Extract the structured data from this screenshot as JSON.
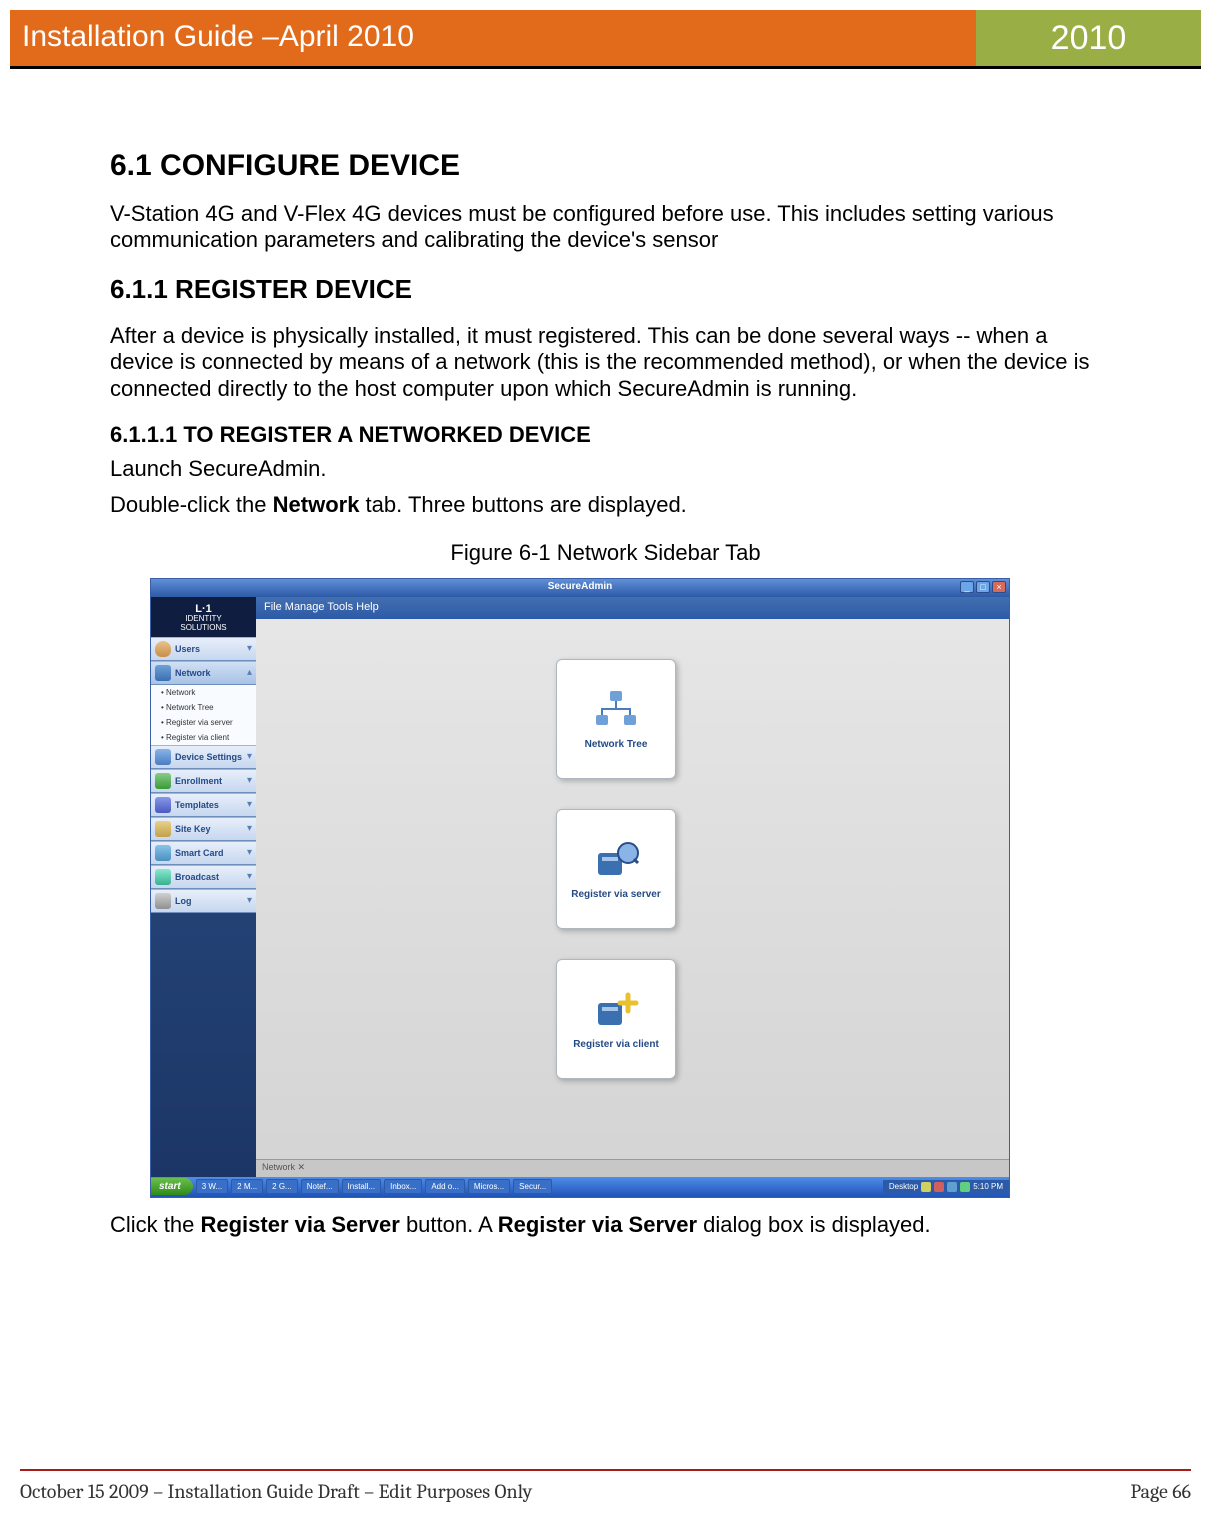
{
  "header": {
    "title": "Installation Guide –April 2010",
    "year": "2010"
  },
  "section": {
    "number_title": "6.1 CONFIGURE DEVICE",
    "intro": "V-Station 4G and V-Flex 4G devices must be configured before use. This includes setting various communication parameters and calibrating the device's sensor",
    "sub_title": "6.1.1 REGISTER DEVICE",
    "sub_body": "After a device is physically installed, it must registered. This can be done several ways -- when a device is connected by means of a network (this is the recommended method), or when the device is connected directly to the host computer upon which SecureAdmin is running.",
    "subsub_title": "6.1.1.1 TO REGISTER A NETWORKED DEVICE",
    "step1": "Launch SecureAdmin.",
    "step2_pre": "Double-click the ",
    "step2_bold": "Network",
    "step2_post": " tab. Three buttons are displayed.",
    "figcap": "Figure 6-1 Network Sidebar Tab",
    "below_pre": "Click the ",
    "below_bold1": "Register via Server",
    "below_mid": " button. A ",
    "below_bold2": "Register via Server",
    "below_post": " dialog box is displayed."
  },
  "screenshot": {
    "title": "SecureAdmin",
    "menus": "File   Manage   Tools   Help",
    "logo_top": "L·1",
    "logo_mid": "IDENTITY",
    "logo_bot": "SOLUTIONS",
    "sidebar": {
      "items": [
        {
          "label": "Users"
        },
        {
          "label": "Network"
        },
        {
          "label": "Device Settings"
        },
        {
          "label": "Enrollment"
        },
        {
          "label": "Templates"
        },
        {
          "label": "Site Key"
        },
        {
          "label": "Smart Card"
        },
        {
          "label": "Broadcast"
        },
        {
          "label": "Log"
        }
      ],
      "network_sub": [
        "Network",
        "Network Tree",
        "Register via server",
        "Register via client"
      ]
    },
    "cards": [
      {
        "label": "Network Tree"
      },
      {
        "label": "Register via server"
      },
      {
        "label": "Register via client"
      }
    ],
    "tab_footer": "Network   ✕",
    "start": "start",
    "taskbar": [
      "3 W...",
      "2 M...",
      "2 G...",
      "Notef...",
      "Install...",
      "Inbox...",
      "Add o...",
      "Micros...",
      "Secur..."
    ],
    "tray_desktop": "Desktop",
    "time": "5:10 PM"
  },
  "footer": {
    "left": "October 15 2009 – Installation Guide Draft – Edit Purposes Only",
    "right": "Page 66"
  }
}
